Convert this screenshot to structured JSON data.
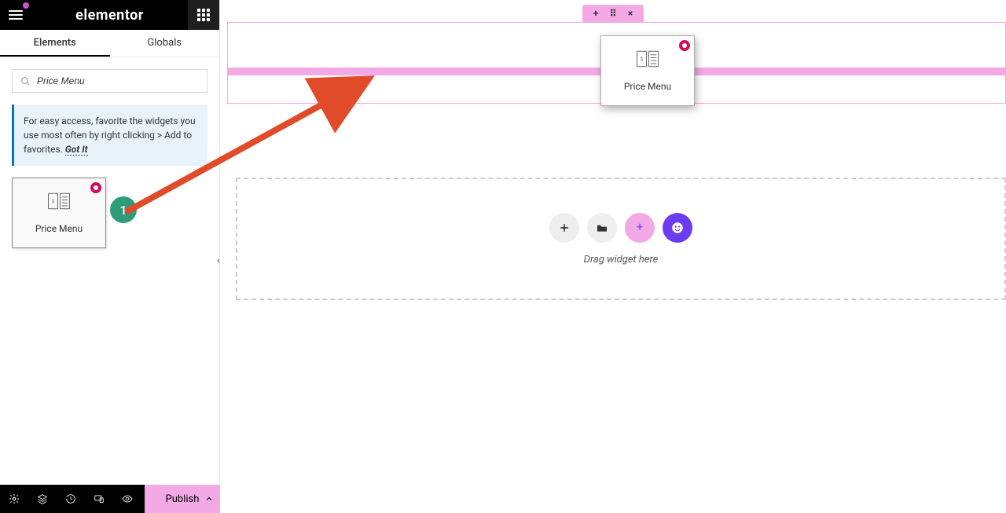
{
  "brand": "elementor",
  "tabs": {
    "elements": "Elements",
    "globals": "Globals"
  },
  "search": {
    "value": "Price Menu"
  },
  "tip": {
    "text": "For easy access, favorite the widgets you use most often by right clicking > Add to favorites.",
    "gotit": "Got It"
  },
  "widgets": {
    "price_menu": {
      "label": "Price Menu"
    }
  },
  "annotation": {
    "step": "1"
  },
  "ghost": {
    "label": "Price Menu"
  },
  "section_controls": {
    "add": "+",
    "drag": "⠿",
    "close": "×"
  },
  "empty_section": {
    "hint": "Drag widget here"
  },
  "bottom": {
    "publish": "Publish"
  }
}
